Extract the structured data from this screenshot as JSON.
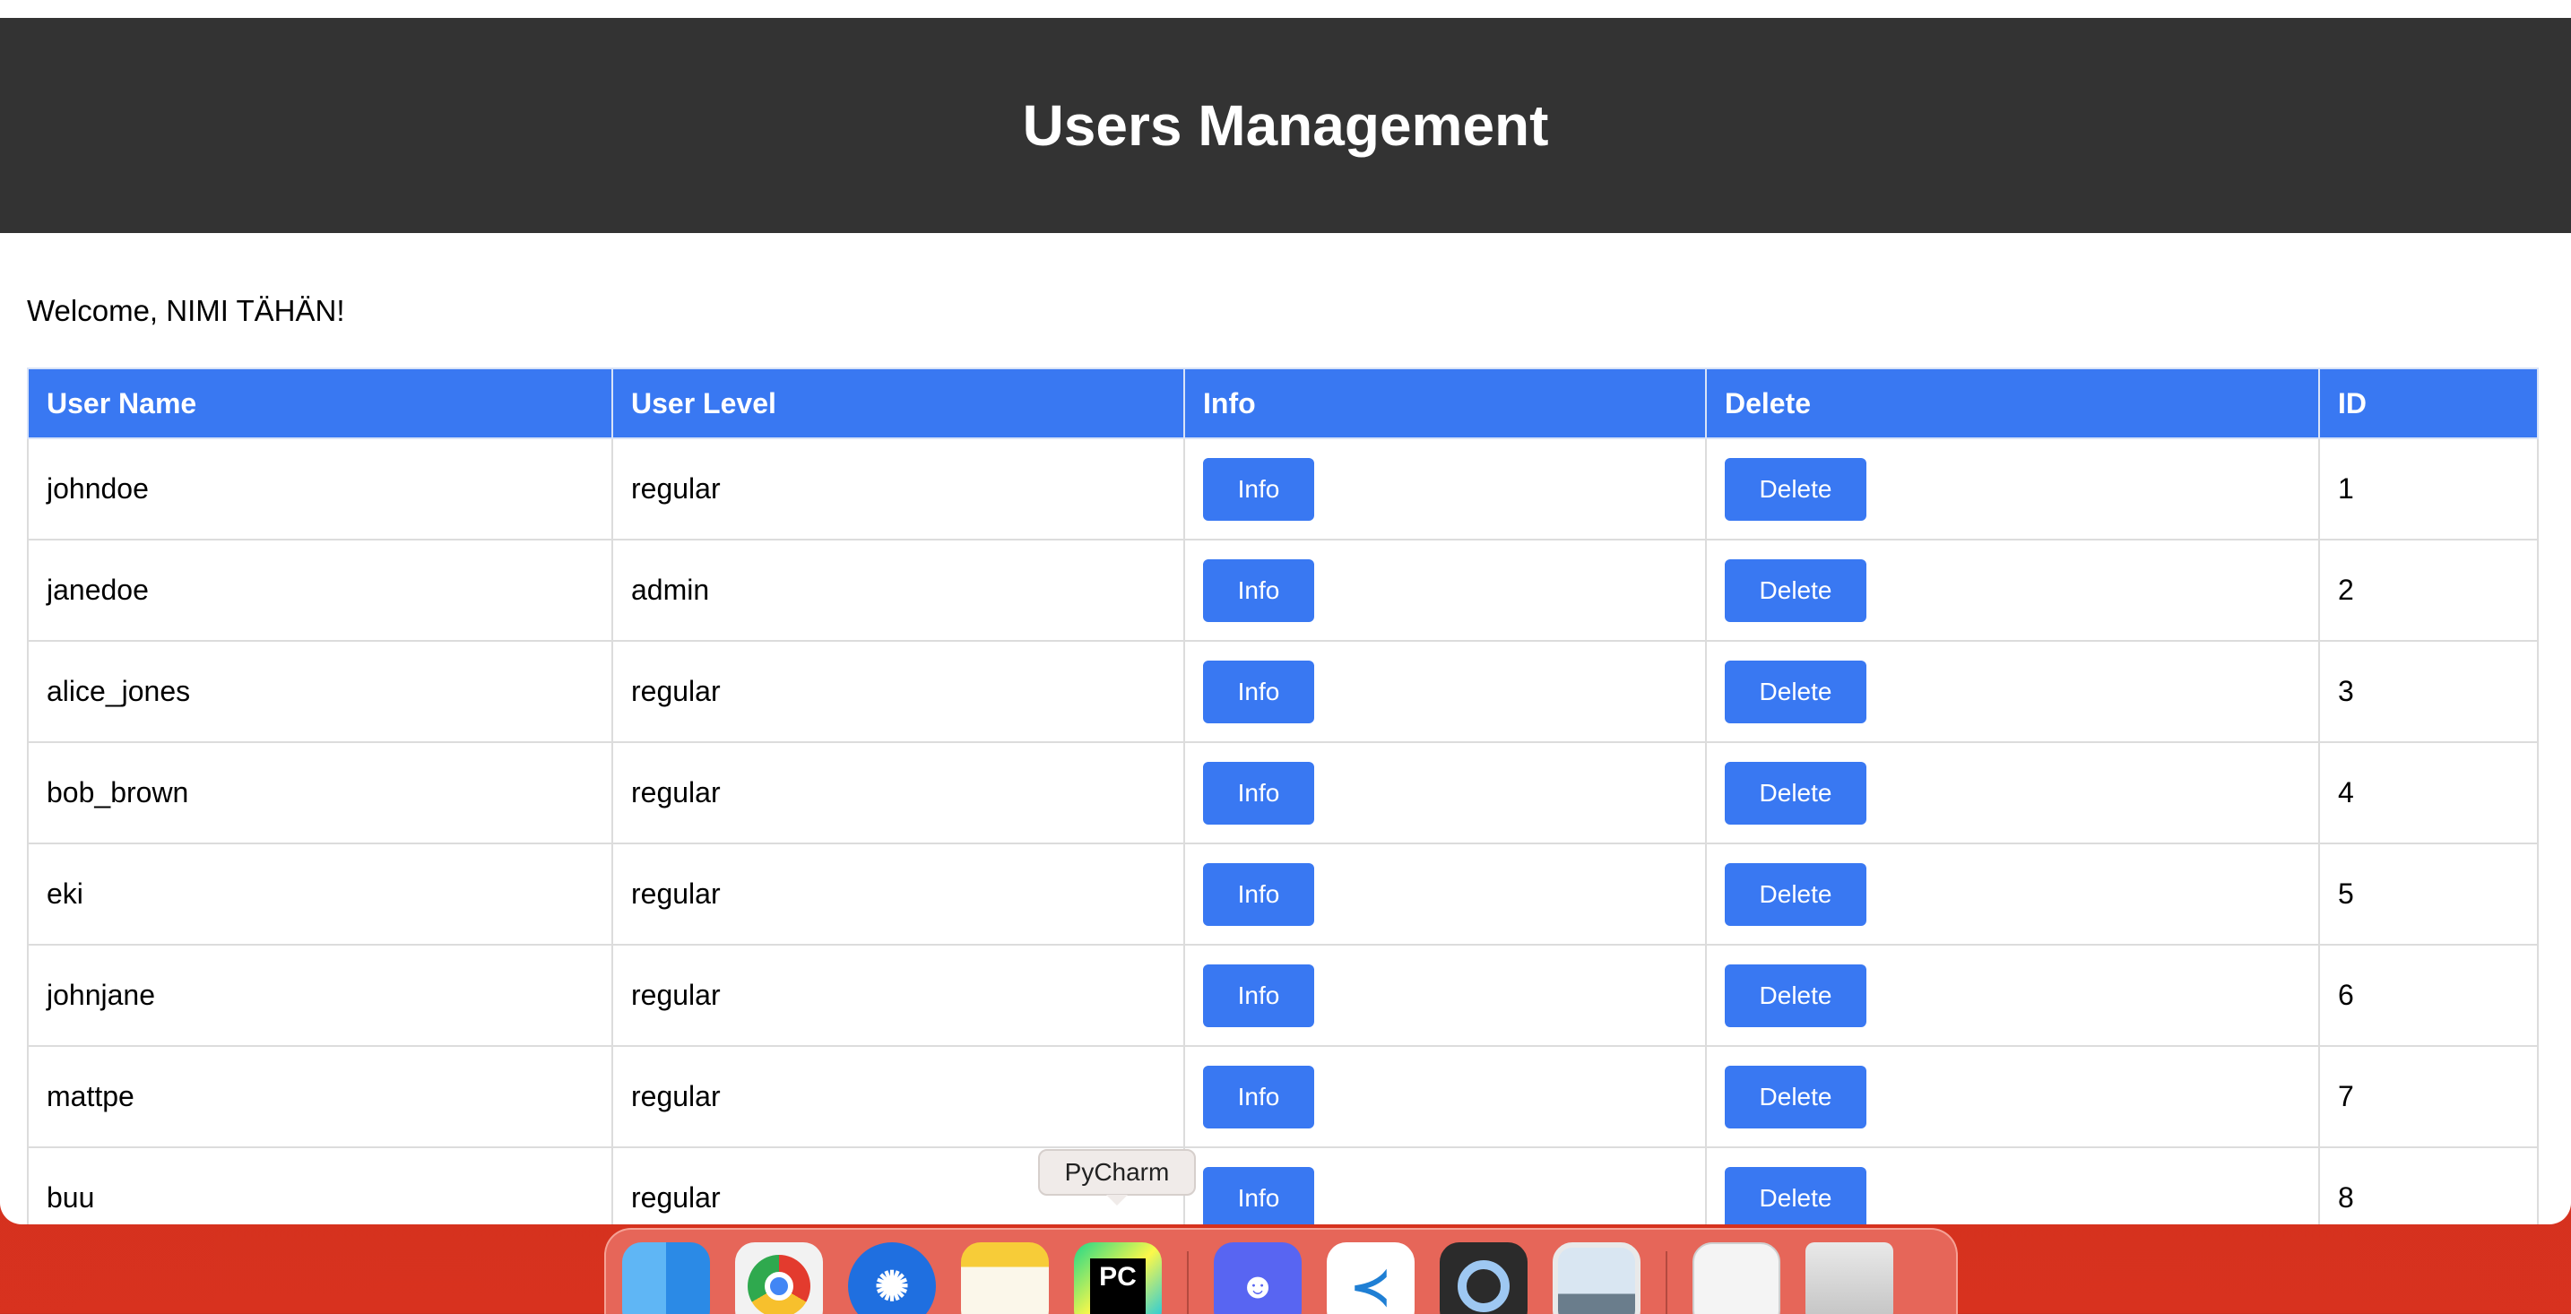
{
  "header": {
    "title": "Users Management"
  },
  "welcome_text": "Welcome, NIMI TÄHÄN!",
  "table": {
    "columns": [
      "User Name",
      "User Level",
      "Info",
      "Delete",
      "ID"
    ],
    "rows": [
      {
        "username": "johndoe",
        "level": "regular",
        "info": "Info",
        "delete": "Delete",
        "id": "1"
      },
      {
        "username": "janedoe",
        "level": "admin",
        "info": "Info",
        "delete": "Delete",
        "id": "2"
      },
      {
        "username": "alice_jones",
        "level": "regular",
        "info": "Info",
        "delete": "Delete",
        "id": "3"
      },
      {
        "username": "bob_brown",
        "level": "regular",
        "info": "Info",
        "delete": "Delete",
        "id": "4"
      },
      {
        "username": "eki",
        "level": "regular",
        "info": "Info",
        "delete": "Delete",
        "id": "5"
      },
      {
        "username": "johnjane",
        "level": "regular",
        "info": "Info",
        "delete": "Delete",
        "id": "6"
      },
      {
        "username": "mattpe",
        "level": "regular",
        "info": "Info",
        "delete": "Delete",
        "id": "7"
      },
      {
        "username": "buu",
        "level": "regular",
        "info": "Info",
        "delete": "Delete",
        "id": "8"
      }
    ]
  },
  "dock": {
    "tooltip": "PyCharm",
    "apps": [
      {
        "name": "Finder",
        "icon": "finder-icon"
      },
      {
        "name": "Google Chrome",
        "icon": "chrome-icon"
      },
      {
        "name": "Battle.net",
        "icon": "battlenet-icon"
      },
      {
        "name": "Notes",
        "icon": "notes-icon"
      },
      {
        "name": "PyCharm",
        "icon": "pycharm-icon",
        "glyph": "PC"
      },
      {
        "name": "Discord",
        "icon": "discord-icon"
      },
      {
        "name": "Visual Studio Code",
        "icon": "vscode-icon"
      },
      {
        "name": "QuickTime Player",
        "icon": "quicktime-icon"
      },
      {
        "name": "Preview",
        "icon": "preview-icon"
      },
      {
        "name": "TextEdit",
        "icon": "textedit-icon"
      },
      {
        "name": "Trash",
        "icon": "trash-icon"
      }
    ]
  },
  "colors": {
    "header_bg": "#333333",
    "accent": "#3978f2",
    "table_border": "#dcdcdc"
  }
}
